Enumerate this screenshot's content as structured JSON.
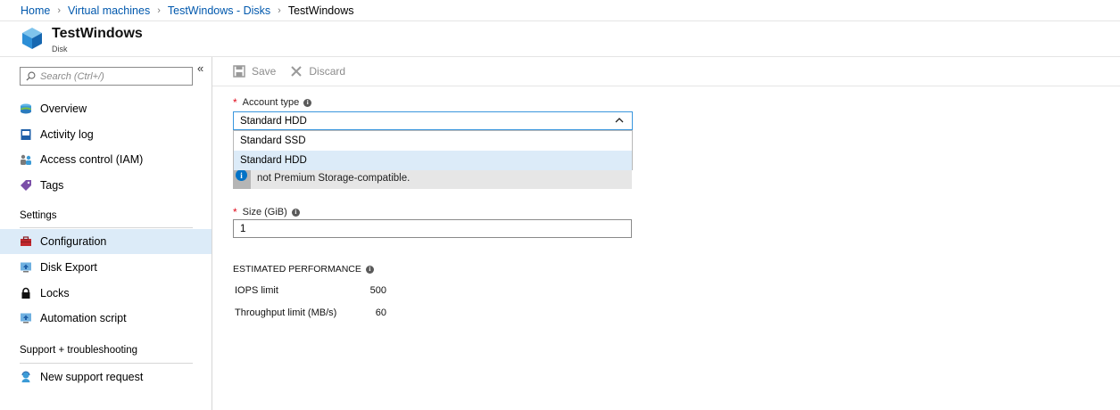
{
  "breadcrumb": {
    "items": [
      "Home",
      "Virtual machines",
      "TestWindows - Disks"
    ],
    "current": "TestWindows"
  },
  "resource": {
    "title": "TestWindows",
    "subtitle": "Disk"
  },
  "sidebar": {
    "search_placeholder": "Search (Ctrl+/)",
    "items": [
      {
        "label": "Overview"
      },
      {
        "label": "Activity log"
      },
      {
        "label": "Access control (IAM)"
      },
      {
        "label": "Tags"
      }
    ],
    "settings_header": "Settings",
    "settings_items": [
      {
        "label": "Configuration",
        "active": true
      },
      {
        "label": "Disk Export"
      },
      {
        "label": "Locks"
      },
      {
        "label": "Automation script"
      }
    ],
    "support_header": "Support + troubleshooting",
    "support_items": [
      {
        "label": "New support request"
      }
    ]
  },
  "toolbar": {
    "save_label": "Save",
    "discard_label": "Discard"
  },
  "form": {
    "account_type_label": "Account type",
    "account_type_value": "Standard HDD",
    "account_type_options": [
      "Standard SSD",
      "Standard HDD"
    ],
    "info_text": "not Premium Storage-compatible.",
    "size_label": "Size (GiB)",
    "size_value": "1"
  },
  "performance": {
    "header": "ESTIMATED PERFORMANCE",
    "rows": [
      {
        "label": "IOPS limit",
        "value": "500"
      },
      {
        "label": "Throughput limit (MB/s)",
        "value": "60"
      }
    ]
  },
  "colors": {
    "link": "#0058ad",
    "active_bg": "#dcebf8",
    "focus_border": "#3a96dd",
    "required": "#e00b1c"
  }
}
